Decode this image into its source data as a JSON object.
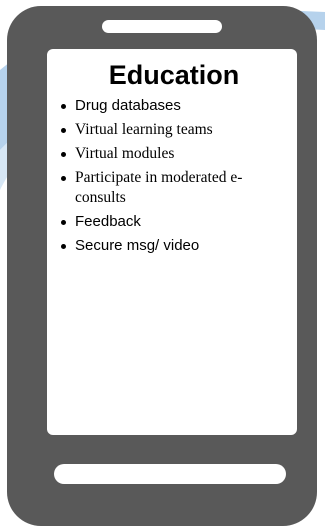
{
  "slide": {
    "title": "Education",
    "bullets": [
      {
        "text": "Drug databases",
        "font": "sans"
      },
      {
        "text": "Virtual learning teams",
        "font": "serif"
      },
      {
        "text": "Virtual modules",
        "font": "serif"
      },
      {
        "text": "Participate in moderated e-consults",
        "font": "serif"
      },
      {
        "text": "Feedback",
        "font": "sans"
      },
      {
        "text": "Secure msg/ video",
        "font": "sans"
      }
    ]
  },
  "colors": {
    "phone_body": "#595959",
    "screen": "#ffffff",
    "swoosh": "#9dc3e6",
    "text": "#000000"
  },
  "icons": {
    "device": "mobile-phone-icon",
    "speaker": "speaker-slot-icon",
    "home": "home-bar-icon"
  }
}
